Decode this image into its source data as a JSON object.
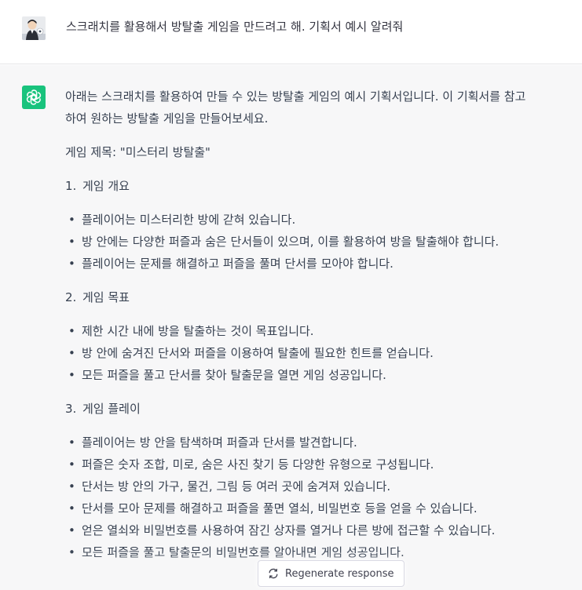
{
  "user_message": {
    "avatar_icon": "user-avatar-photo",
    "text": "스크래치를 활용해서 방탈출 게임을 만드려고 해. 기획서 예시 알려줘"
  },
  "assistant_message": {
    "avatar_icon": "openai-logo-icon",
    "accent_color": "#19c37d",
    "intro_line1": "아래는 스크래치를 활용하여 만들 수 있는 방탈출 게임의 예시 기획서입니다. 이 기획서를 참고",
    "intro_line2": "하여 원하는 방탈출 게임을 만들어보세요.",
    "game_title": "게임 제목: \"미스터리 방탈출\"",
    "sections": [
      {
        "number": "1.",
        "heading": "게임 개요",
        "items": [
          "플레이어는 미스터리한 방에 갇혀 있습니다.",
          "방 안에는 다양한 퍼즐과 숨은 단서들이 있으며, 이를 활용하여 방을 탈출해야 합니다.",
          "플레이어는 문제를 해결하고 퍼즐을 풀며 단서를 모아야 합니다."
        ]
      },
      {
        "number": "2.",
        "heading": "게임 목표",
        "items": [
          "제한 시간 내에 방을 탈출하는 것이 목표입니다.",
          "방 안에 숨겨진 단서와 퍼즐을 이용하여 탈출에 필요한 힌트를 얻습니다.",
          "모든 퍼즐을 풀고 단서를 찾아 탈출문을 열면 게임 성공입니다."
        ]
      },
      {
        "number": "3.",
        "heading": "게임 플레이",
        "items": [
          "플레이어는 방 안을 탐색하며 퍼즐과 단서를 발견합니다.",
          "퍼즐은 숫자 조합, 미로, 숨은 사진 찾기 등 다양한 유형으로 구성됩니다.",
          "단서는 방 안의 가구, 물건, 그림 등 여러 곳에 숨겨져 있습니다.",
          "단서를 모아 문제를 해결하고 퍼즐을 풀면 열쇠, 비밀번호 등을 얻을 수 있습니다.",
          "얻은 열쇠와 비밀번호를 사용하여 잠긴 상자를 열거나 다른 방에 접근할 수 있습니다.",
          "모든 퍼즐을 풀고 탈출문의 비밀번호를 알아내면 게임 성공입니다."
        ]
      }
    ]
  },
  "regenerate_button": {
    "icon": "refresh-icon",
    "label": "Regenerate response"
  }
}
